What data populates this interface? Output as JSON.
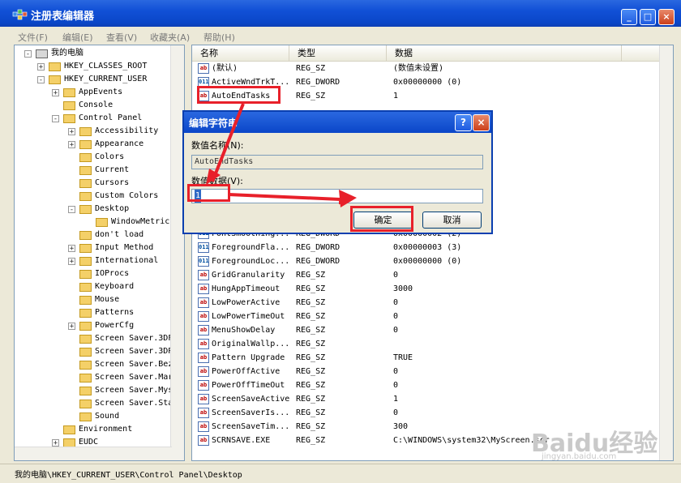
{
  "window": {
    "title": "注册表编辑器",
    "min_label": "_",
    "max_label": "□",
    "close_label": "×"
  },
  "menubar": [
    "文件(F)",
    "编辑(E)",
    "查看(V)",
    "收藏夹(A)",
    "帮助(H)"
  ],
  "tree": [
    {
      "label": "我的电脑",
      "level": 0,
      "expander": "-"
    },
    {
      "label": "HKEY_CLASSES_ROOT",
      "level": 1,
      "expander": "+"
    },
    {
      "label": "HKEY_CURRENT_USER",
      "level": 1,
      "expander": "-"
    },
    {
      "label": "AppEvents",
      "level": 2,
      "expander": "+"
    },
    {
      "label": "Console",
      "level": 2,
      "expander": ""
    },
    {
      "label": "Control Panel",
      "level": 2,
      "expander": "-"
    },
    {
      "label": "Accessibility",
      "level": 3,
      "expander": "+"
    },
    {
      "label": "Appearance",
      "level": 3,
      "expander": "+"
    },
    {
      "label": "Colors",
      "level": 3,
      "expander": ""
    },
    {
      "label": "Current",
      "level": 3,
      "expander": ""
    },
    {
      "label": "Cursors",
      "level": 3,
      "expander": ""
    },
    {
      "label": "Custom Colors",
      "level": 3,
      "expander": ""
    },
    {
      "label": "Desktop",
      "level": 3,
      "expander": "-"
    },
    {
      "label": "WindowMetrics",
      "level": 4,
      "expander": ""
    },
    {
      "label": "don't load",
      "level": 3,
      "expander": ""
    },
    {
      "label": "Input Method",
      "level": 3,
      "expander": "+"
    },
    {
      "label": "International",
      "level": 3,
      "expander": "+"
    },
    {
      "label": "IOProcs",
      "level": 3,
      "expander": ""
    },
    {
      "label": "Keyboard",
      "level": 3,
      "expander": ""
    },
    {
      "label": "Mouse",
      "level": 3,
      "expander": ""
    },
    {
      "label": "Patterns",
      "level": 3,
      "expander": ""
    },
    {
      "label": "PowerCfg",
      "level": 3,
      "expander": "+"
    },
    {
      "label": "Screen Saver.3DF",
      "level": 3,
      "expander": ""
    },
    {
      "label": "Screen Saver.3DP",
      "level": 3,
      "expander": ""
    },
    {
      "label": "Screen Saver.Bez",
      "level": 3,
      "expander": ""
    },
    {
      "label": "Screen Saver.Mar",
      "level": 3,
      "expander": ""
    },
    {
      "label": "Screen Saver.Mys",
      "level": 3,
      "expander": ""
    },
    {
      "label": "Screen Saver.Sta",
      "level": 3,
      "expander": ""
    },
    {
      "label": "Sound",
      "level": 3,
      "expander": ""
    },
    {
      "label": "Environment",
      "level": 2,
      "expander": ""
    },
    {
      "label": "EUDC",
      "level": 2,
      "expander": "+"
    }
  ],
  "columns": [
    "名称",
    "类型",
    "数据"
  ],
  "rows": [
    {
      "icon": "string",
      "name": "(默认)",
      "type": "REG_SZ",
      "data": "(数值未设置)"
    },
    {
      "icon": "binary",
      "name": "ActiveWndTrkT...",
      "type": "REG_DWORD",
      "data": "0x00000000 (0)"
    },
    {
      "icon": "string",
      "name": "AutoEndTasks",
      "type": "REG_SZ",
      "data": "1"
    },
    {
      "icon": "binary",
      "name": "FontSmoothing...",
      "type": "REG_DWORD",
      "data": "0x00000002 (2)"
    },
    {
      "icon": "binary",
      "name": "ForegroundFla...",
      "type": "REG_DWORD",
      "data": "0x00000003 (3)"
    },
    {
      "icon": "binary",
      "name": "ForegroundLoc...",
      "type": "REG_DWORD",
      "data": "0x00000000 (0)"
    },
    {
      "icon": "string",
      "name": "GridGranularity",
      "type": "REG_SZ",
      "data": "0"
    },
    {
      "icon": "string",
      "name": "HungAppTimeout",
      "type": "REG_SZ",
      "data": "3000"
    },
    {
      "icon": "string",
      "name": "LowPowerActive",
      "type": "REG_SZ",
      "data": "0"
    },
    {
      "icon": "string",
      "name": "LowPowerTimeOut",
      "type": "REG_SZ",
      "data": "0"
    },
    {
      "icon": "string",
      "name": "MenuShowDelay",
      "type": "REG_SZ",
      "data": "0"
    },
    {
      "icon": "string",
      "name": "OriginalWallp...",
      "type": "REG_SZ",
      "data": ""
    },
    {
      "icon": "string",
      "name": "Pattern Upgrade",
      "type": "REG_SZ",
      "data": "TRUE"
    },
    {
      "icon": "string",
      "name": "PowerOffActive",
      "type": "REG_SZ",
      "data": "0"
    },
    {
      "icon": "string",
      "name": "PowerOffTimeOut",
      "type": "REG_SZ",
      "data": "0"
    },
    {
      "icon": "string",
      "name": "ScreenSaveActive",
      "type": "REG_SZ",
      "data": "1"
    },
    {
      "icon": "string",
      "name": "ScreenSaverIs...",
      "type": "REG_SZ",
      "data": "0"
    },
    {
      "icon": "string",
      "name": "ScreenSaveTim...",
      "type": "REG_SZ",
      "data": "300"
    },
    {
      "icon": "string",
      "name": "SCRNSAVE.EXE",
      "type": "REG_SZ",
      "data": "C:\\WINDOWS\\system32\\MyScreen.scr"
    }
  ],
  "dialog": {
    "title": "编辑字符串",
    "help_label": "?",
    "close_label": "×",
    "name_label": "数值名称(N):",
    "name_value": "AutoEndTasks",
    "data_label": "数值数据(V):",
    "data_value": "1",
    "ok_label": "确定",
    "cancel_label": "取消"
  },
  "status": "我的电脑\\HKEY_CURRENT_USER\\Control Panel\\Desktop",
  "watermark": {
    "text": "Baidu经验",
    "sub": "jingyan.baidu.com"
  },
  "colors": {
    "accent": "#0a46c8",
    "highlight": "#e8202a",
    "selection": "#316ac5"
  }
}
